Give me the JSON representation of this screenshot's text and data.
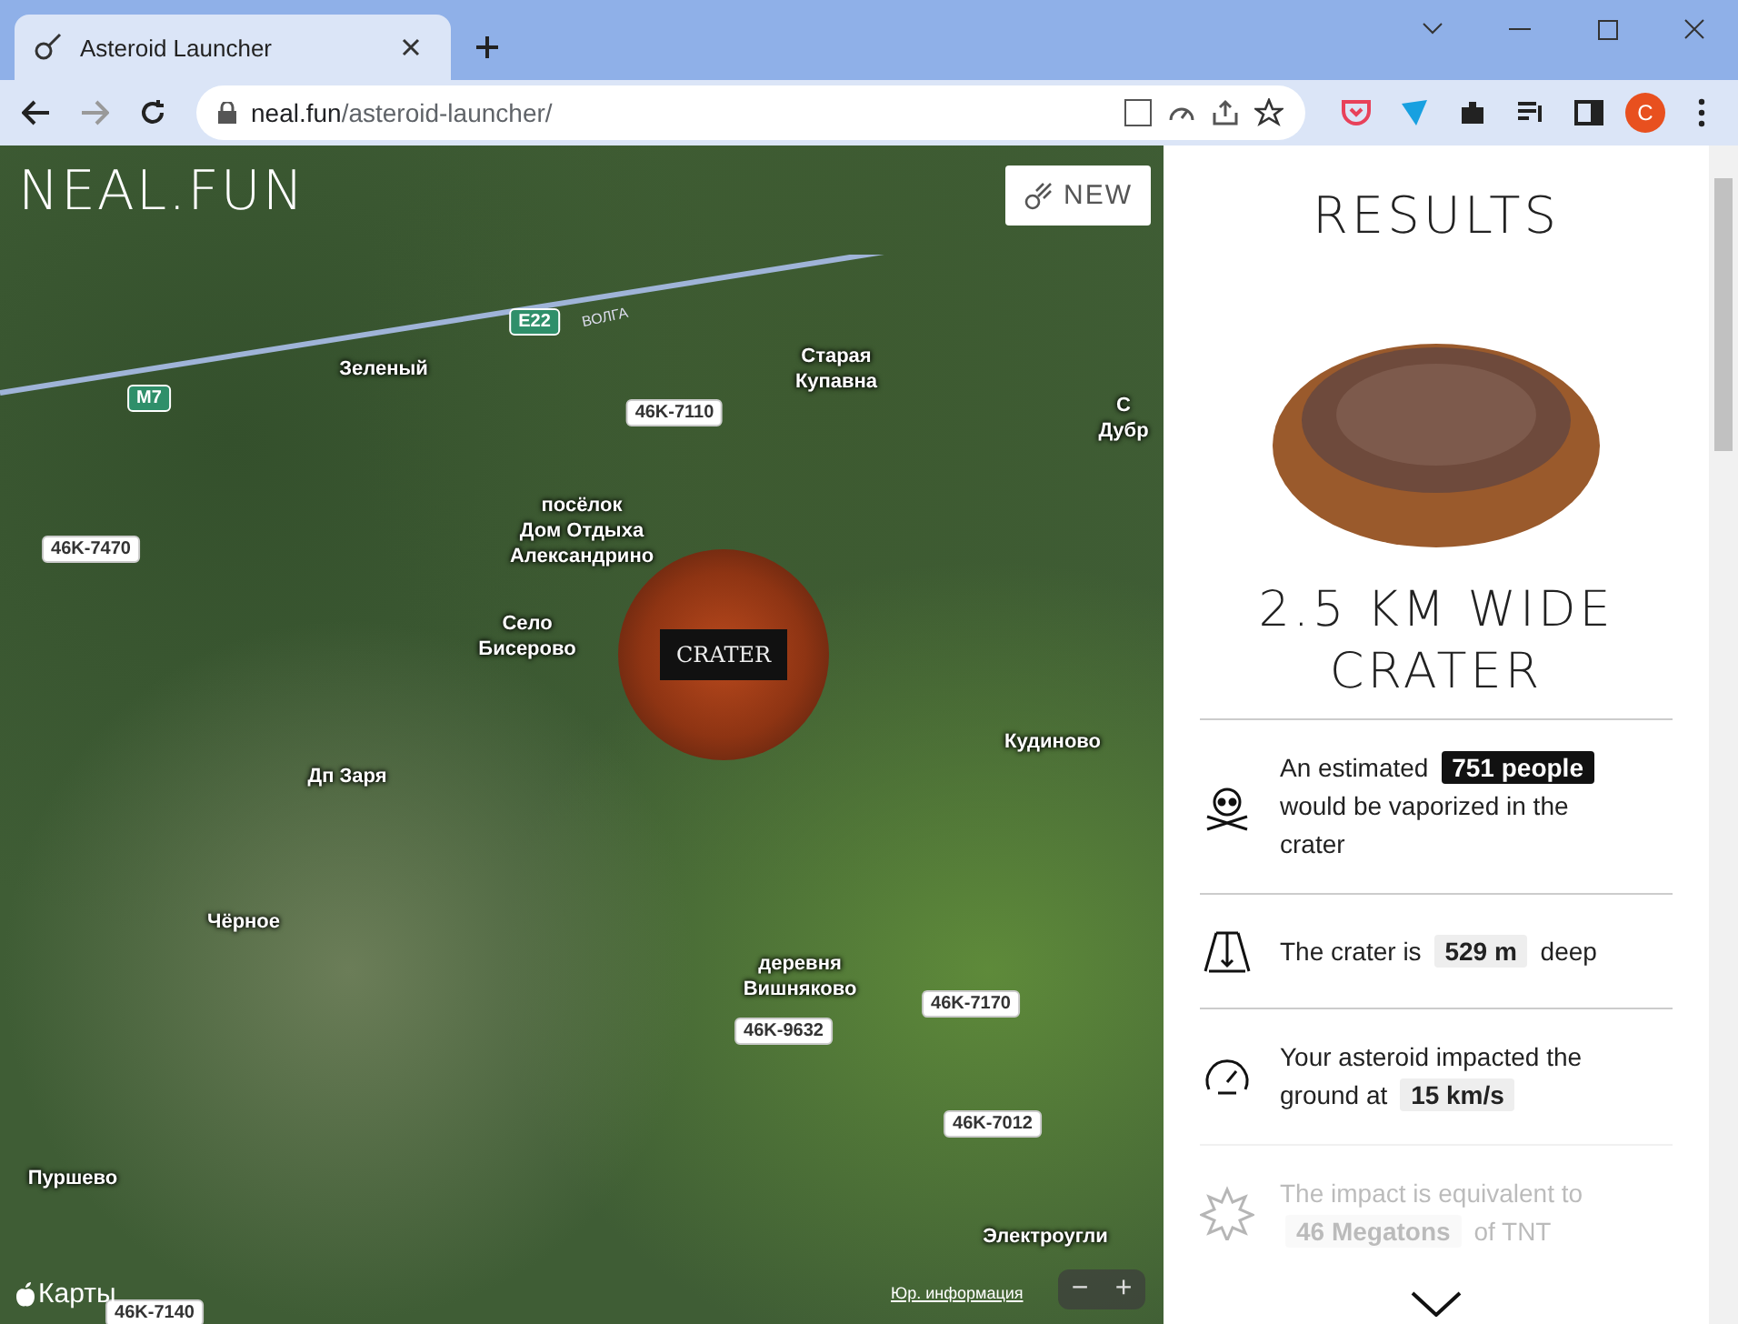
{
  "browser": {
    "tab_title": "Asteroid Launcher",
    "url_host": "neal.fun",
    "url_path": "/asteroid-launcher/",
    "profile_initial": "C"
  },
  "map": {
    "logo": "NEAL.FUN",
    "new_button": "NEW",
    "impact_label": "CRATER",
    "places": [
      {
        "lines": [
          "Зеленый"
        ]
      },
      {
        "lines": [
          "Старая",
          "Купавна"
        ]
      },
      {
        "lines": [
          "С",
          "Дубр"
        ]
      },
      {
        "lines": [
          "посёлок",
          "Дом Отдыха",
          "Александрино"
        ]
      },
      {
        "lines": [
          "Село",
          "Бисерово"
        ]
      },
      {
        "lines": [
          "Кудиново"
        ]
      },
      {
        "lines": [
          "Дп Заря"
        ]
      },
      {
        "lines": [
          "Чёрное"
        ]
      },
      {
        "lines": [
          "деревня",
          "Вишняково"
        ]
      },
      {
        "lines": [
          "Пуршево"
        ]
      },
      {
        "lines": [
          "Электроугли"
        ]
      }
    ],
    "roads": [
      {
        "kind": "highway",
        "label": "M7"
      },
      {
        "kind": "highway",
        "label": "E22"
      },
      {
        "kind": "regional",
        "label": "46K-7110"
      },
      {
        "kind": "regional",
        "label": "46K-7470"
      },
      {
        "kind": "regional",
        "label": "46K-7170"
      },
      {
        "kind": "regional",
        "label": "46K-9632"
      },
      {
        "kind": "regional",
        "label": "46K-7012"
      },
      {
        "kind": "regional",
        "label": "46K-7140"
      }
    ],
    "road_name": "ВОЛГА",
    "attribution": "Карты",
    "legal_link": "Юр. информация",
    "zoom_out": "−",
    "zoom_in": "+"
  },
  "results": {
    "title": "RESULTS",
    "headline": "2.5 KM WIDE CRATER",
    "items": [
      {
        "kind": "casualties",
        "before": "An estimated",
        "value": "751 people",
        "after": "would be vaporized in the crater",
        "emphasized": true,
        "faded": false
      },
      {
        "kind": "depth",
        "before": "The crater is",
        "value": "529 m",
        "after": "deep",
        "emphasized": false,
        "faded": false
      },
      {
        "kind": "speed",
        "before": "Your asteroid impacted the ground at",
        "value": "15 km/s",
        "emphasized": false,
        "faded": false
      },
      {
        "kind": "energy",
        "before": "The impact is equivalent to",
        "value": "46 Megatons",
        "after": "of TNT",
        "emphasized": false,
        "faded": true
      }
    ]
  }
}
